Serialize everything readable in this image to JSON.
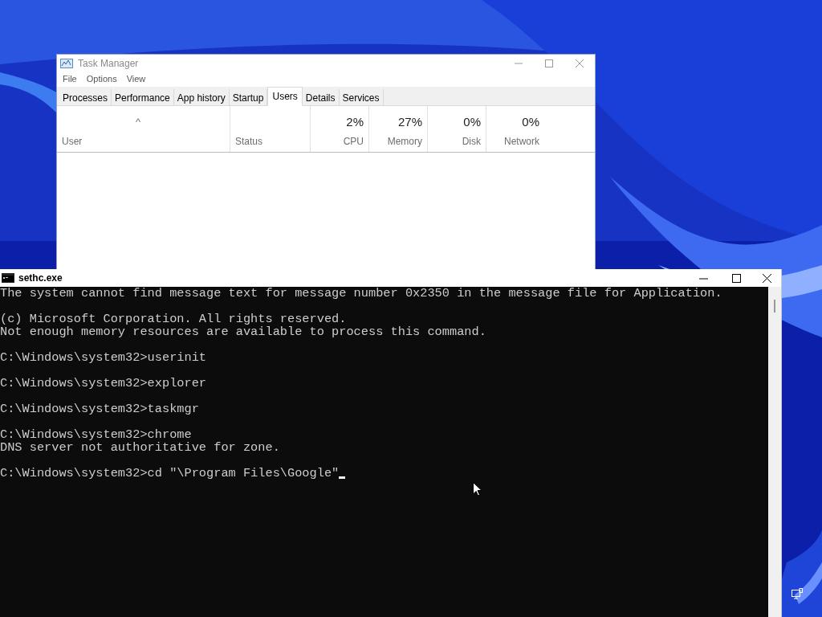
{
  "task_manager": {
    "title": "Task Manager",
    "menu": [
      "File",
      "Options",
      "View"
    ],
    "tabs": [
      {
        "label": "Processes",
        "selected": false
      },
      {
        "label": "Performance",
        "selected": false
      },
      {
        "label": "App history",
        "selected": false
      },
      {
        "label": "Startup",
        "selected": false
      },
      {
        "label": "Users",
        "selected": true
      },
      {
        "label": "Details",
        "selected": false
      },
      {
        "label": "Services",
        "selected": false
      }
    ],
    "sort_indicator": "^",
    "columns": [
      {
        "label": "User",
        "kind": "text"
      },
      {
        "label": "Status",
        "kind": "text"
      },
      {
        "label": "CPU",
        "value": "2%",
        "kind": "metric"
      },
      {
        "label": "Memory",
        "value": "27%",
        "kind": "metric"
      },
      {
        "label": "Disk",
        "value": "0%",
        "kind": "metric"
      },
      {
        "label": "Network",
        "value": "0%",
        "kind": "metric"
      }
    ]
  },
  "console": {
    "title": "sethc.exe",
    "blocks": [
      [
        "The system cannot find message text for message number 0x2350 in the message file for Application."
      ],
      [
        "(c) Microsoft Corporation. All rights reserved.",
        "Not enough memory resources are available to process this command."
      ],
      [
        "C:\\Windows\\system32>userinit"
      ],
      [
        "C:\\Windows\\system32>explorer"
      ],
      [
        "C:\\Windows\\system32>taskmgr"
      ],
      [
        "C:\\Windows\\system32>chrome",
        "DNS server not authoritative for zone."
      ],
      [
        "C:\\Windows\\system32>cd \"\\Program Files\\Google\""
      ]
    ]
  }
}
